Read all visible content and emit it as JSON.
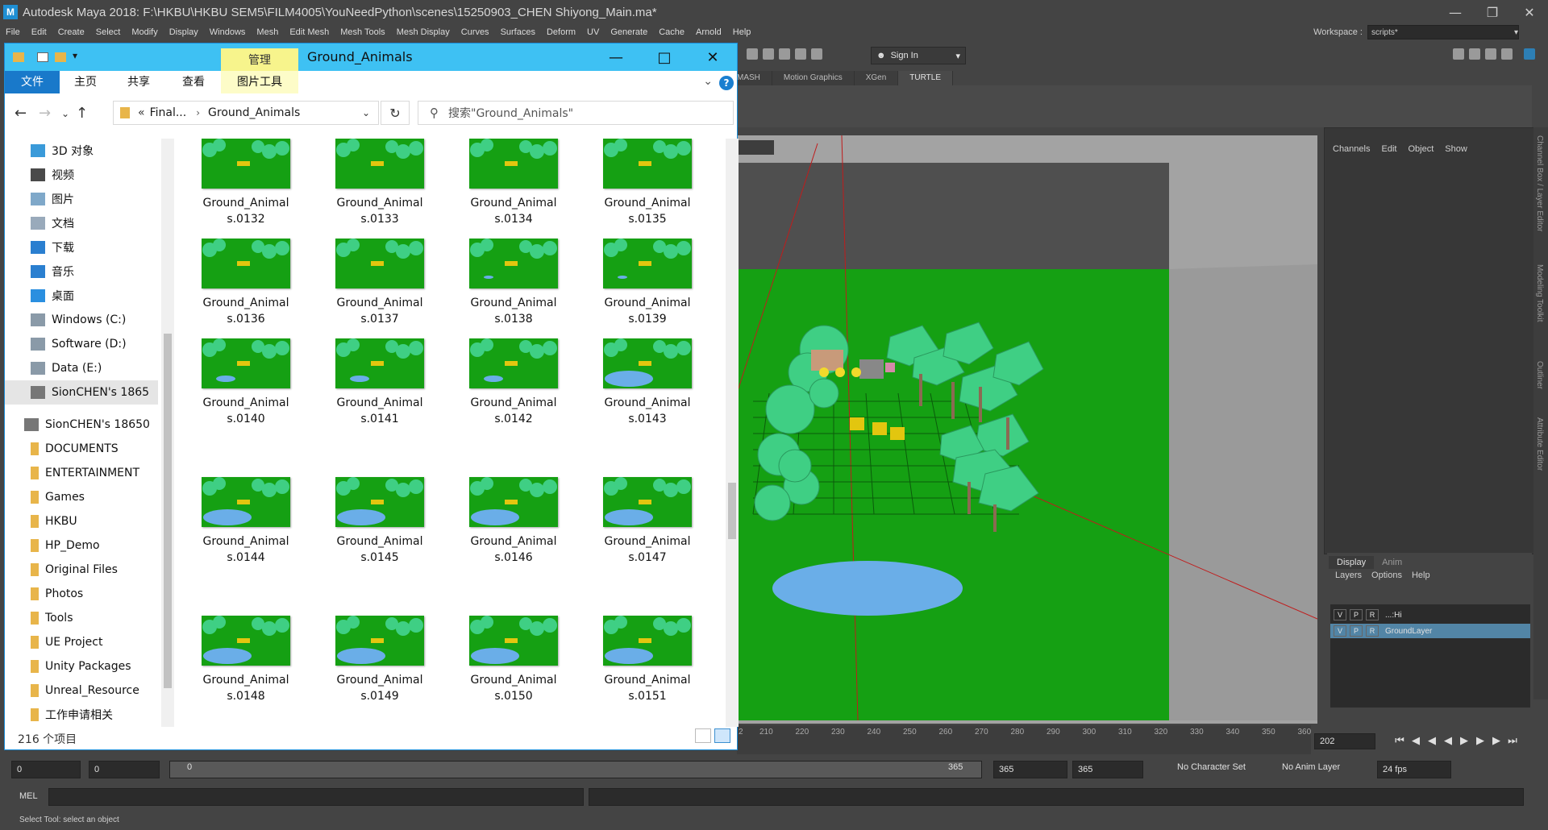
{
  "maya": {
    "title": "Autodesk Maya 2018: F:\\HKBU\\HKBU SEM5\\FILM4005\\YouNeedPython\\scenes\\15250903_CHEN Shiyong_Main.ma*",
    "menus": [
      "File",
      "Edit",
      "Create",
      "Select",
      "Modify",
      "Display",
      "Windows",
      "Mesh",
      "Edit Mesh",
      "Mesh Tools",
      "Mesh Display",
      "Curves",
      "Surfaces",
      "Deform",
      "UV",
      "Generate",
      "Cache",
      "Arnold",
      "Help"
    ],
    "workspace_label": "Workspace :",
    "workspace_value": "scripts*",
    "sign_in": "Sign In",
    "shelf_tabs": [
      "MASH",
      "Motion Graphics",
      "XGen",
      "TURTLE"
    ],
    "channel_box_menus": [
      "Channels",
      "Edit",
      "Object",
      "Show"
    ],
    "vertical_tabs": [
      "Channel Box / Layer Editor",
      "Modeling Toolkit",
      "Outliner",
      "Attribute Editor"
    ],
    "layer_tabs": [
      "Display",
      "Anim"
    ],
    "layer_menus": [
      "Layers",
      "Options",
      "Help"
    ],
    "layers": [
      {
        "v": "V",
        "p": "P",
        "r": "R",
        "name": "...:Hi",
        "selected": false
      },
      {
        "v": "V",
        "p": "P",
        "r": "R",
        "name": "GroundLayer",
        "selected": true
      }
    ],
    "timeline_ticks": [
      "2",
      "210",
      "220",
      "230",
      "240",
      "250",
      "260",
      "270",
      "280",
      "290",
      "300",
      "310",
      "320",
      "330",
      "340",
      "350",
      "360"
    ],
    "current_frame": "202",
    "range": {
      "start": "0",
      "start_inner": "0",
      "slider_start": "0",
      "slider_end": "365",
      "end_inner": "365",
      "end": "365"
    },
    "character_set": "No Character Set",
    "anim_layer": "No Anim Layer",
    "fps": "24 fps",
    "mel_label": "MEL",
    "help_line": "Select Tool: select an object"
  },
  "explorer": {
    "window_title": "Ground_Animals",
    "manage_tab": "管理",
    "ribbon_tabs": [
      "文件",
      "主页",
      "共享",
      "查看",
      "图片工具"
    ],
    "address_parent": "Final...",
    "address_current": "Ground_Animals",
    "search_placeholder": "搜索\"Ground_Animals\"",
    "nav_items": [
      {
        "label": "3D 对象",
        "icon": "3d-objects-icon"
      },
      {
        "label": "视频",
        "icon": "video-icon"
      },
      {
        "label": "图片",
        "icon": "pictures-icon"
      },
      {
        "label": "文档",
        "icon": "documents-icon"
      },
      {
        "label": "下载",
        "icon": "download-icon"
      },
      {
        "label": "音乐",
        "icon": "music-icon"
      },
      {
        "label": "桌面",
        "icon": "desktop-icon"
      },
      {
        "label": "Windows (C:)",
        "icon": "drive-icon"
      },
      {
        "label": "Software (D:)",
        "icon": "drive-icon"
      },
      {
        "label": "Data (E:)",
        "icon": "drive-icon"
      },
      {
        "label": "SionCHEN's 1865",
        "icon": "network-drive-icon",
        "selected": true
      },
      {
        "label": "SionCHEN's 18650",
        "icon": "network-drive-icon"
      },
      {
        "label": "DOCUMENTS",
        "icon": "folder-icon"
      },
      {
        "label": "ENTERTAINMENT",
        "icon": "folder-icon"
      },
      {
        "label": "Games",
        "icon": "folder-icon"
      },
      {
        "label": "HKBU",
        "icon": "folder-icon"
      },
      {
        "label": "HP_Demo",
        "icon": "folder-icon"
      },
      {
        "label": "Original Files",
        "icon": "folder-icon"
      },
      {
        "label": "Photos",
        "icon": "folder-icon"
      },
      {
        "label": "Tools",
        "icon": "folder-icon"
      },
      {
        "label": "UE Project",
        "icon": "folder-icon"
      },
      {
        "label": "Unity Packages",
        "icon": "folder-icon"
      },
      {
        "label": "Unreal_Resource",
        "icon": "folder-icon"
      },
      {
        "label": "工作申请相关",
        "icon": "folder-icon"
      }
    ],
    "files": [
      {
        "name": "Ground_Animal\ns.0132",
        "pond": "none"
      },
      {
        "name": "Ground_Animal\ns.0133",
        "pond": "none"
      },
      {
        "name": "Ground_Animal\ns.0134",
        "pond": "none"
      },
      {
        "name": "Ground_Animal\ns.0135",
        "pond": "none"
      },
      {
        "name": "Ground_Animal\ns.0136",
        "pond": "none"
      },
      {
        "name": "Ground_Animal\ns.0137",
        "pond": "none"
      },
      {
        "name": "Ground_Animal\ns.0138",
        "pond": "tiny"
      },
      {
        "name": "Ground_Animal\ns.0139",
        "pond": "tiny"
      },
      {
        "name": "Ground_Animal\ns.0140",
        "pond": "small"
      },
      {
        "name": "Ground_Animal\ns.0141",
        "pond": "small"
      },
      {
        "name": "Ground_Animal\ns.0142",
        "pond": "small"
      },
      {
        "name": "Ground_Animal\ns.0143",
        "pond": "large"
      },
      {
        "name": "Ground_Animal\ns.0144",
        "pond": "large"
      },
      {
        "name": "Ground_Animal\ns.0145",
        "pond": "large"
      },
      {
        "name": "Ground_Animal\ns.0146",
        "pond": "large"
      },
      {
        "name": "Ground_Animal\ns.0147",
        "pond": "large"
      },
      {
        "name": "Ground_Animal\ns.0148",
        "pond": "large"
      },
      {
        "name": "Ground_Animal\ns.0149",
        "pond": "large"
      },
      {
        "name": "Ground_Animal\ns.0150",
        "pond": "large"
      },
      {
        "name": "Ground_Animal\ns.0151",
        "pond": "large"
      }
    ],
    "status": "216 个项目"
  },
  "colors": {
    "accent": "#3ec1f3",
    "file_tab": "#1979ca",
    "grass": "#15a013",
    "pond": "#6aaee8",
    "tree": "#3fcf84"
  }
}
